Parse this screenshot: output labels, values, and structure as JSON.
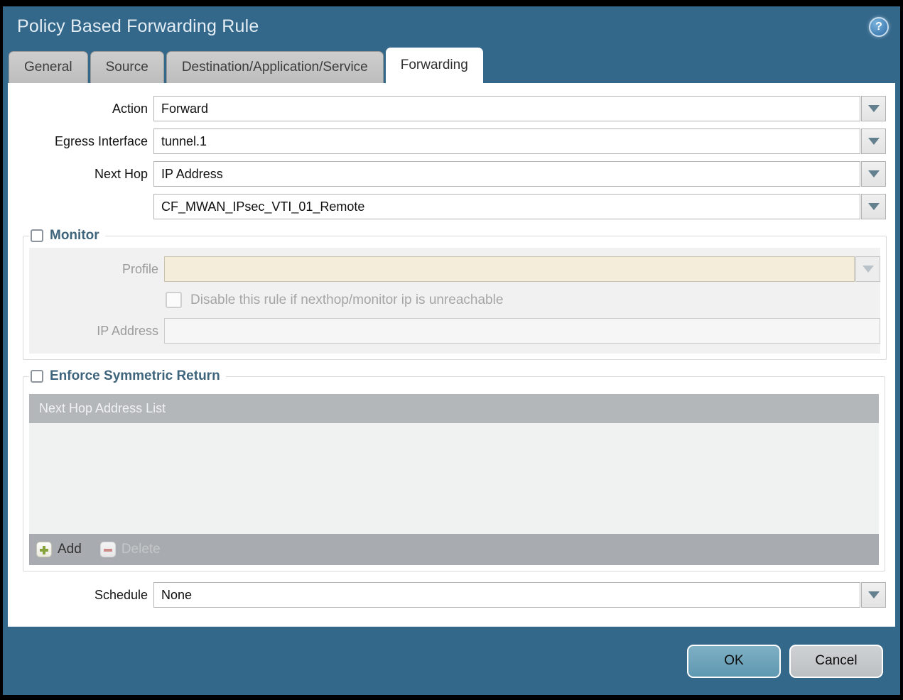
{
  "window": {
    "title": "Policy Based Forwarding Rule"
  },
  "icons": {
    "help": "?"
  },
  "tabs": {
    "items": [
      {
        "label": "General",
        "active": false
      },
      {
        "label": "Source",
        "active": false
      },
      {
        "label": "Destination/Application/Service",
        "active": false
      },
      {
        "label": "Forwarding",
        "active": true
      }
    ]
  },
  "form": {
    "action": {
      "label": "Action",
      "value": "Forward"
    },
    "egress_interface": {
      "label": "Egress Interface",
      "value": "tunnel.1"
    },
    "next_hop": {
      "label": "Next Hop",
      "value": "IP Address"
    },
    "next_hop_address": {
      "value": "CF_MWAN_IPsec_VTI_01_Remote"
    },
    "schedule": {
      "label": "Schedule",
      "value": "None"
    }
  },
  "monitor": {
    "title": "Monitor",
    "checked": false,
    "profile_label": "Profile",
    "profile_value": "",
    "disable_label": "Disable this rule if nexthop/monitor ip is unreachable",
    "disable_checked": false,
    "ip_label": "IP Address",
    "ip_value": ""
  },
  "symmetric_return": {
    "title": "Enforce Symmetric Return",
    "checked": false,
    "table_header": "Next Hop Address List",
    "rows": [],
    "add_label": "Add",
    "delete_label": "Delete"
  },
  "footer": {
    "ok_label": "OK",
    "cancel_label": "Cancel"
  },
  "colors": {
    "accent_teal": "#34688b",
    "ok_button": "#69a2ba",
    "disabled_beige": "#f3edda",
    "table_header_gray": "#b3b7ba",
    "add_plus_green": "#86a33c",
    "delete_minus_red": "#cd8d8d"
  }
}
